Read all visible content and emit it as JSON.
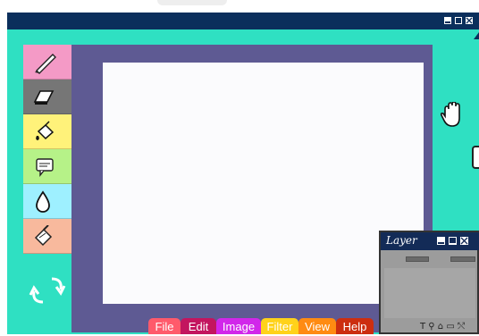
{
  "window": {
    "controls": [
      "minimize",
      "maximize",
      "close"
    ]
  },
  "colors": {
    "titlebar": "#0b2f5c",
    "window_bg": "#2fe0c2",
    "frame": "#5e5a93",
    "canvas": "#fbfbfd"
  },
  "toolbar": {
    "tools": [
      {
        "name": "brush",
        "icon": "brush-icon",
        "color": "#f49ac6"
      },
      {
        "name": "eraser",
        "icon": "eraser-icon",
        "color": "#767676"
      },
      {
        "name": "fill",
        "icon": "paint-bucket-icon",
        "color": "#fff27a"
      },
      {
        "name": "text",
        "icon": "speech-bubble-icon",
        "color": "#b6f288"
      },
      {
        "name": "eyedropper",
        "icon": "droplet-icon",
        "color": "#9ef0ff"
      },
      {
        "name": "smudge",
        "icon": "smudge-icon",
        "color": "#f8b99d"
      }
    ],
    "undo_redo_icon": "undo-redo-icon"
  },
  "right_tools": {
    "hand_icon": "hand-icon"
  },
  "menu": [
    {
      "label": "File",
      "color": "#ff5a6b"
    },
    {
      "label": "Edit",
      "color": "#c3155f"
    },
    {
      "label": "Image",
      "color": "#d127ea"
    },
    {
      "label": "Filter",
      "color": "#ffd21a"
    },
    {
      "label": "View",
      "color": "#ff8b12"
    },
    {
      "label": "Help",
      "color": "#cc2e10"
    }
  ],
  "layer_panel": {
    "title": "Layer",
    "footer_icons": "T ⚲ ⌂ ▭ ⤲"
  }
}
